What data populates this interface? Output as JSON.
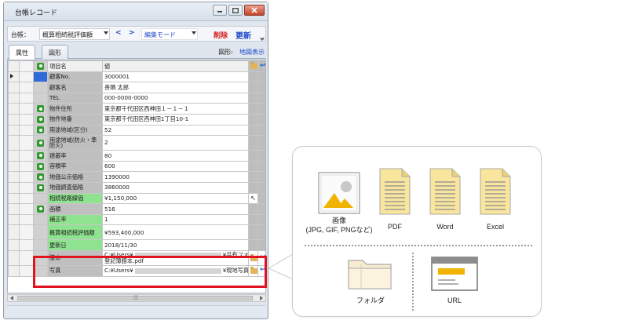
{
  "window": {
    "title": "台帳レコード",
    "toolbar": {
      "ledger_label": "台帳：",
      "ledger_value": "概算相続税評価額",
      "prev": "<",
      "next": ">",
      "mode": "編集モード",
      "delete": "削除",
      "update": "更新"
    },
    "tabs": [
      "属性",
      "図形"
    ],
    "figure_label": "図形:",
    "map_link": "地図表示"
  },
  "grid": {
    "header": {
      "name": "項目名",
      "value": "値"
    },
    "rows": [
      {
        "name": "顧客No.",
        "value": "3000001"
      },
      {
        "name": "顧客名",
        "value": "善隣 太郎"
      },
      {
        "name": "TEL",
        "value": "000-0000-0000"
      },
      {
        "name": "物件住所",
        "value": "東京都千代田区西神田１－１－１"
      },
      {
        "name": "物件地番",
        "value": "東京都千代田区西神田1丁目10-1"
      },
      {
        "name": "用途地域(区分)",
        "value": "52"
      },
      {
        "name": "用途地域(防火・準防火)",
        "value": "2"
      },
      {
        "name": "建蔽率",
        "value": "80"
      },
      {
        "name": "容積率",
        "value": "600"
      },
      {
        "name": "地価公示価格",
        "value": "1390000"
      },
      {
        "name": "地価調査価格",
        "value": "3860000"
      },
      {
        "name": "相続税路線価",
        "value": "¥1,150,000"
      },
      {
        "name": "画積",
        "value": "516"
      },
      {
        "name": "補正率",
        "value": "1"
      },
      {
        "name": "概算相続税評価額",
        "value": "¥593,400,000"
      },
      {
        "name": "更新日",
        "value": "2018/11/30"
      },
      {
        "name": "謄本",
        "value_line1_prefix": "C:¥Users¥",
        "value_line1_suffix": "¥共有フォルダ¥",
        "value_line2": "登記簿謄本.pdf"
      },
      {
        "name": "写真",
        "value_prefix": "C:¥Users¥",
        "value_suffix": "¥現地写真"
      }
    ]
  },
  "callout": {
    "items": [
      {
        "label_line1": "画像",
        "label_line2": "(JPG, GIF, PNGなど)",
        "icon": "image-icon"
      },
      {
        "label": "PDF",
        "icon": "document-icon"
      },
      {
        "label": "Word",
        "icon": "document-icon"
      },
      {
        "label": "Excel",
        "icon": "document-icon"
      },
      {
        "label": "フォルダ",
        "icon": "folder-icon"
      },
      {
        "label": "URL",
        "icon": "browser-window-icon"
      }
    ]
  },
  "colors": {
    "highlight": "#e0141e",
    "accent_blue": "#1f46c8",
    "delete_red": "#d21a1a",
    "green_cell": "#8fe28f"
  }
}
